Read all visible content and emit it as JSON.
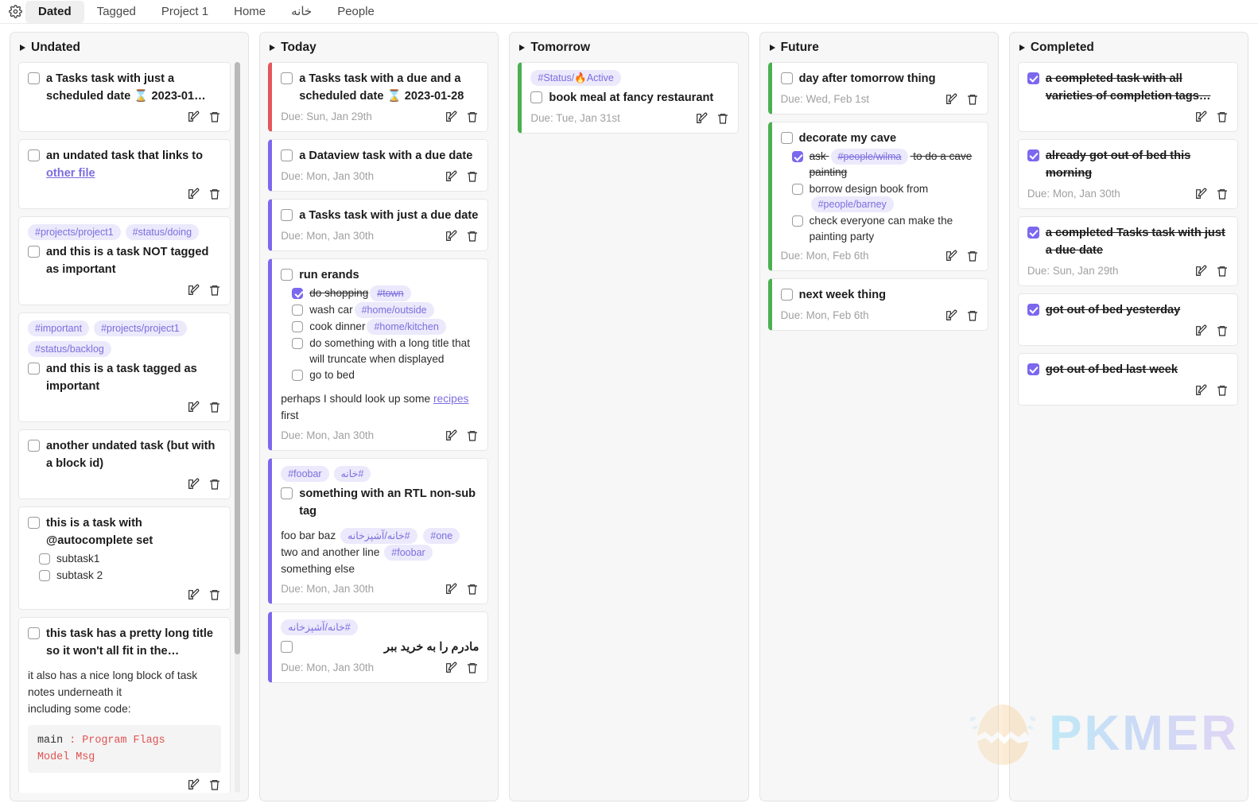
{
  "tabbar": {
    "gear_icon": "gear-icon",
    "tabs": [
      {
        "label": "Dated",
        "active": true
      },
      {
        "label": "Tagged",
        "active": false
      },
      {
        "label": "Project 1",
        "active": false
      },
      {
        "label": "Home",
        "active": false
      },
      {
        "label": "خانه",
        "active": false
      },
      {
        "label": "People",
        "active": false
      }
    ]
  },
  "colors": {
    "accent_overdue": "#e4565a",
    "accent_due": "#7b68ee",
    "accent_future": "#4caf50",
    "tag_bg": "#ebe9fb",
    "tag_fg": "#7c6ee0",
    "checkbox_checked": "#7b68ee",
    "column_bg": "#f7f7f7",
    "card_bg": "#ffffff",
    "due_text": "#a0a0a0"
  },
  "icons": {
    "edit": "edit-pencil-icon",
    "delete": "trash-icon",
    "collapse": "triangle-right-icon"
  },
  "watermark": {
    "text": "PKMER",
    "icon": "cracked-egg-icon"
  },
  "columns": [
    {
      "title": "Undated",
      "has_scrollbar": true,
      "cards": [
        {
          "accent": "none",
          "tags": [],
          "checked": false,
          "title": "a Tasks task with just a scheduled date ⌛ 2023-01…",
          "due": "",
          "subs": [],
          "notes": [],
          "code": null
        },
        {
          "accent": "none",
          "tags": [],
          "checked": false,
          "title": "an undated task that links to ",
          "title_link": "other file",
          "due": "",
          "subs": [],
          "notes": [],
          "code": null
        },
        {
          "accent": "none",
          "tags": [
            "#projects/project1",
            "#status/doing"
          ],
          "checked": false,
          "title": "and this is a task NOT tagged as important",
          "due": "",
          "subs": [],
          "notes": [],
          "code": null
        },
        {
          "accent": "none",
          "tags": [
            "#important",
            "#projects/project1",
            "#status/backlog"
          ],
          "checked": false,
          "title": "and this is a task tagged as important",
          "due": "",
          "subs": [],
          "notes": [],
          "code": null
        },
        {
          "accent": "none",
          "tags": [],
          "checked": false,
          "title": "another undated task (but with a block id)",
          "due": "",
          "subs": [],
          "notes": [],
          "code": null
        },
        {
          "accent": "none",
          "tags": [],
          "checked": false,
          "title": "this is a task with @autocomplete set",
          "due": "",
          "subs": [
            {
              "checked": false,
              "text": "subtask1"
            },
            {
              "checked": false,
              "text": "subtask 2"
            }
          ],
          "notes": [],
          "code": null
        },
        {
          "accent": "none",
          "tags": [],
          "checked": false,
          "title": "this task has a pretty long title so it won't all fit in the…",
          "due": "",
          "subs": [],
          "notes": [
            "it also has a nice long block of task notes underneath it",
            "including some code:"
          ],
          "code": "main : Program Flags\nModel Msg"
        }
      ]
    },
    {
      "title": "Today",
      "has_scrollbar": false,
      "cards": [
        {
          "accent": "red",
          "tags": [],
          "checked": false,
          "title": "a Tasks task with a due and a scheduled date ⌛ 2023-01-28",
          "due": "Due: Sun, Jan 29th",
          "subs": [],
          "notes": [],
          "code": null
        },
        {
          "accent": "purple",
          "tags": [],
          "checked": false,
          "title": "a Dataview task with a due date",
          "due": "Due: Mon, Jan 30th",
          "subs": [],
          "notes": [],
          "code": null
        },
        {
          "accent": "purple",
          "tags": [],
          "checked": false,
          "title": "a Tasks task with just a due date",
          "due": "Due: Mon, Jan 30th",
          "subs": [],
          "notes": [],
          "code": null
        },
        {
          "accent": "purple",
          "tags": [],
          "checked": false,
          "title": "run erands",
          "due": "Due: Mon, Jan 30th",
          "subs": [
            {
              "checked": true,
              "text": "do shopping",
              "tag": "#town",
              "tag_struck": true
            },
            {
              "checked": false,
              "text": "wash car",
              "tag": "#home/outside"
            },
            {
              "checked": false,
              "text": "cook dinner",
              "tag": "#home/kitchen"
            },
            {
              "checked": false,
              "text": "do something with a long title that will truncate when displayed"
            },
            {
              "checked": false,
              "text": "go to bed"
            }
          ],
          "notes_rich": {
            "before": "perhaps I should look up some ",
            "link": "recipes",
            "after": " first"
          },
          "notes": [],
          "code": null
        },
        {
          "accent": "purple",
          "tags": [
            "#foobar",
            "#خانه"
          ],
          "checked": false,
          "title": "something with an RTL non-sub tag",
          "due": "Due: Mon, Jan 30th",
          "subs": [],
          "notes_tagged": [
            {
              "text": "foo bar baz "
            },
            {
              "tag": "#خانه/آشپزخانه"
            },
            {
              "text": " "
            },
            {
              "tag": "#one"
            },
            {
              "text": " two and another line "
            },
            {
              "tag": "#foobar"
            },
            {
              "text": " something else"
            }
          ],
          "notes": [],
          "code": null
        },
        {
          "accent": "purple",
          "tags": [
            "#خانه/آشپزخانه"
          ],
          "checked": false,
          "title": "مادرم را به خرید ببر",
          "title_rtl": true,
          "due": "Due: Mon, Jan 30th",
          "subs": [],
          "notes": [],
          "code": null
        }
      ]
    },
    {
      "title": "Tomorrow",
      "has_scrollbar": false,
      "cards": [
        {
          "accent": "green",
          "tags": [
            "#Status/🔥Active"
          ],
          "checked": false,
          "title": "book meal at fancy restaurant",
          "due": "Due: Tue, Jan 31st",
          "subs": [],
          "notes": [],
          "code": null
        }
      ]
    },
    {
      "title": "Future",
      "has_scrollbar": false,
      "cards": [
        {
          "accent": "green",
          "tags": [],
          "checked": false,
          "title": "day after tomorrow thing",
          "due": "Due: Wed, Feb 1st",
          "subs": [],
          "notes": [],
          "code": null
        },
        {
          "accent": "green",
          "tags": [],
          "checked": false,
          "title": "decorate my cave",
          "due": "Due: Mon, Feb 6th",
          "subs": [
            {
              "checked": true,
              "text": "ask ",
              "tag": "#people/wilma",
              "tag_struck": true,
              "text_after": " to do a cave painting"
            },
            {
              "checked": false,
              "text": "borrow design book from ",
              "tag": "#people/barney"
            },
            {
              "checked": false,
              "text": "check everyone can make the painting party"
            }
          ],
          "notes": [],
          "code": null
        },
        {
          "accent": "green",
          "tags": [],
          "checked": false,
          "title": "next week thing",
          "due": "Due: Mon, Feb 6th",
          "subs": [],
          "notes": [],
          "code": null
        }
      ]
    },
    {
      "title": "Completed",
      "has_scrollbar": false,
      "cards": [
        {
          "accent": "none",
          "tags": [],
          "checked": true,
          "title": "a completed task with all varieties of completion tags…",
          "due": "",
          "subs": [],
          "notes": [],
          "code": null
        },
        {
          "accent": "none",
          "tags": [],
          "checked": true,
          "title": "already got out of bed this morning",
          "due": "Due: Mon, Jan 30th",
          "subs": [],
          "notes": [],
          "code": null
        },
        {
          "accent": "none",
          "tags": [],
          "checked": true,
          "title": "a completed Tasks task with just a due date",
          "due": "Due: Sun, Jan 29th",
          "subs": [],
          "notes": [],
          "code": null
        },
        {
          "accent": "none",
          "tags": [],
          "checked": true,
          "title": "got out of bed yesterday",
          "due": "",
          "subs": [],
          "notes": [],
          "code": null
        },
        {
          "accent": "none",
          "tags": [],
          "checked": true,
          "title": "got out of bed last week",
          "due": "",
          "subs": [],
          "notes": [],
          "code": null
        }
      ]
    }
  ]
}
